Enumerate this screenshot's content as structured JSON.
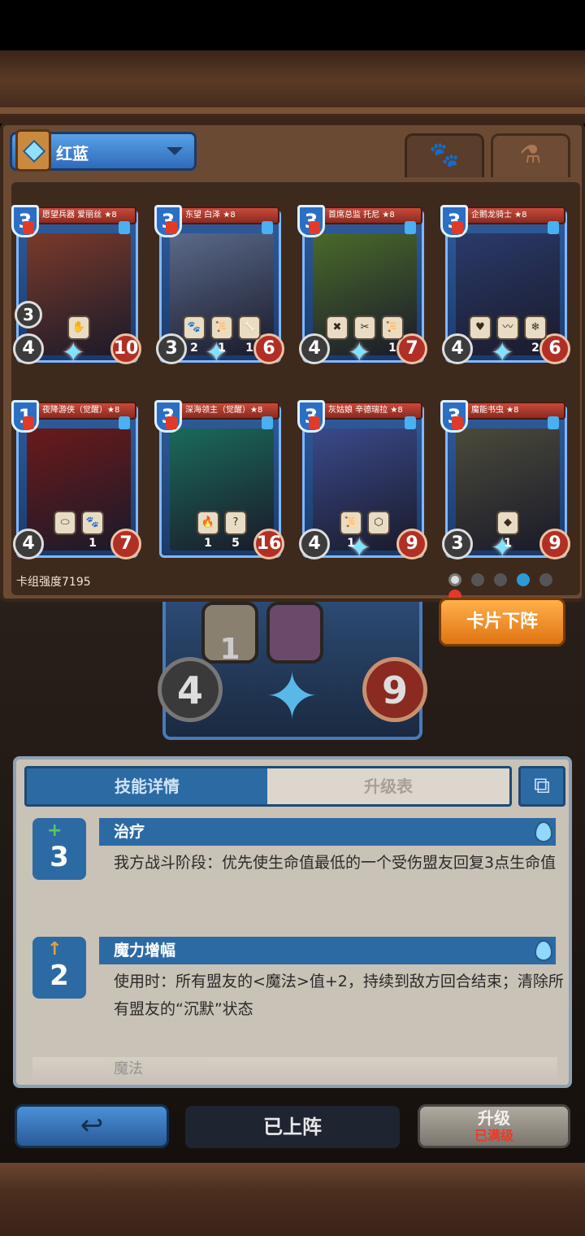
{
  "deck": {
    "name": "红蓝",
    "power_label": "卡组强度7195"
  },
  "tabs": {
    "paw_glyph": "🐾",
    "potion_glyph": "⚗"
  },
  "cards": [
    {
      "name": "愿望兵器 爱丽丝 ★8",
      "cost": "3",
      "attack": "4",
      "health": "10",
      "side_value": "3",
      "skills": [
        "✋"
      ],
      "skill_levels": [
        ""
      ],
      "art_color": "#7a3a2a"
    },
    {
      "name": "东望 白泽 ★8",
      "cost": "3",
      "attack": "3",
      "health": "6",
      "side_value": "",
      "skills": [
        "🐾",
        "📜",
        "🦴"
      ],
      "skill_levels": [
        "2",
        "1",
        "1"
      ],
      "art_color": "#5a6a8a"
    },
    {
      "name": "首席总监 托尼 ★8",
      "cost": "3",
      "attack": "4",
      "health": "7",
      "side_value": "",
      "skills": [
        "✖",
        "✂",
        "📜"
      ],
      "skill_levels": [
        "",
        "",
        "1"
      ],
      "art_color": "#4a6a2a"
    },
    {
      "name": "企鹅龙骑士 ★8",
      "cost": "3",
      "attack": "4",
      "health": "6",
      "side_value": "",
      "skills": [
        "♥",
        "〰",
        "❄"
      ],
      "skill_levels": [
        "",
        "",
        "2"
      ],
      "art_color": "#2a3a6a"
    },
    {
      "name": "夜降游侠（觉醒）★8",
      "cost": "1",
      "attack": "4",
      "health": "7",
      "side_value": "",
      "skills": [
        "⬭",
        "🐾"
      ],
      "skill_levels": [
        "",
        "1"
      ],
      "art_color": "#6a1a1a"
    },
    {
      "name": "深海领主（觉醒）★8",
      "cost": "3",
      "attack": "",
      "health": "16",
      "side_value": "",
      "skills": [
        "🔥",
        "?"
      ],
      "skill_levels": [
        "1",
        "5"
      ],
      "art_color": "#1a6a5a"
    },
    {
      "name": "灰姑娘 辛德瑞拉 ★8",
      "cost": "3",
      "attack": "4",
      "health": "9",
      "side_value": "",
      "skills": [
        "📜",
        "⬡"
      ],
      "skill_levels": [
        "1",
        ""
      ],
      "art_color": "#3a4a8a"
    },
    {
      "name": "魔能书虫 ★8",
      "cost": "3",
      "attack": "3",
      "health": "9",
      "side_value": "",
      "skills": [
        "◆"
      ],
      "skill_levels": [
        "1"
      ],
      "art_color": "#4a4a3a"
    }
  ],
  "buttons": {
    "unequip": "卡片下阵",
    "back_glyph": "↩",
    "equipped": "已上阵",
    "upgrade": "升级",
    "upgrade_status": "已满级"
  },
  "preview": {
    "attack": "4",
    "health": "9",
    "skill_level": "1"
  },
  "detail": {
    "tab_skill": "技能详情",
    "tab_upgrade": "升级表",
    "skills": [
      {
        "title": "治疗",
        "level": "3",
        "glyph": "+",
        "desc": "我方战斗阶段：优先使生命值最低的一个受伤盟友回复3点生命值"
      },
      {
        "title": "魔力增幅",
        "level": "2",
        "glyph": "↑",
        "desc": "使用时：所有盟友的<魔法>值+2，持续到敌方回合结束；清除所有盟友的“沉默”状态"
      }
    ],
    "faded_title": "魔法"
  },
  "colors": {
    "accent_blue": "#2c6aa4",
    "orange": "#e07414",
    "red": "#e83a2a"
  }
}
